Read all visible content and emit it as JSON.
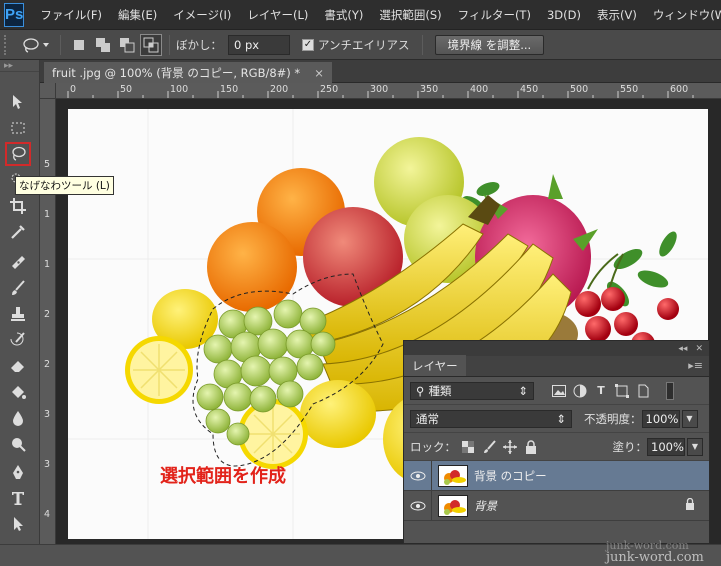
{
  "app": {
    "logo": "Ps"
  },
  "menubar": {
    "items": [
      "ファイル(F)",
      "編集(E)",
      "イメージ(I)",
      "レイヤー(L)",
      "書式(Y)",
      "選択範囲(S)",
      "フィルター(T)",
      "3D(D)",
      "表示(V)",
      "ウィンドウ(W"
    ]
  },
  "options": {
    "feather_label": "ぼかし：",
    "feather_value": "0 px",
    "antialias_label": "アンチエイリアス",
    "antialias_checked": true,
    "refine_edge_button": "境界線 を調整..."
  },
  "tooltip": {
    "text": "なげなわツール (L)"
  },
  "document": {
    "tab_title": "fruit .jpg @ 100% (背景 のコピー, RGB/8#) *",
    "close": "×"
  },
  "rulers": {
    "horizontal": [
      "0",
      "50",
      "100",
      "150",
      "200",
      "250",
      "300",
      "350",
      "400",
      "450",
      "500",
      "550",
      "600"
    ],
    "vertical": [
      "5",
      "1",
      "1",
      "2",
      "2",
      "3",
      "3",
      "4"
    ]
  },
  "annotation": {
    "text": "選択範囲を作成",
    "color": "#e2231a"
  },
  "layers_panel": {
    "tab": "レイヤー",
    "filter_kind": "種類",
    "blend_mode": "通常",
    "opacity_label": "不透明度：",
    "opacity_value": "100%",
    "lock_label": "ロック：",
    "fill_label": "塗り：",
    "fill_value": "100%",
    "layers": [
      {
        "name": "背景 のコピー",
        "selected": true,
        "locked": false
      },
      {
        "name": "背景",
        "selected": false,
        "locked": true
      }
    ]
  },
  "watermark": {
    "line1": "junk-word.com",
    "line2": "junk-word.com"
  },
  "colors": {
    "accent_selected_layer": "#667a93",
    "tool_highlight": "#d22a2a"
  }
}
